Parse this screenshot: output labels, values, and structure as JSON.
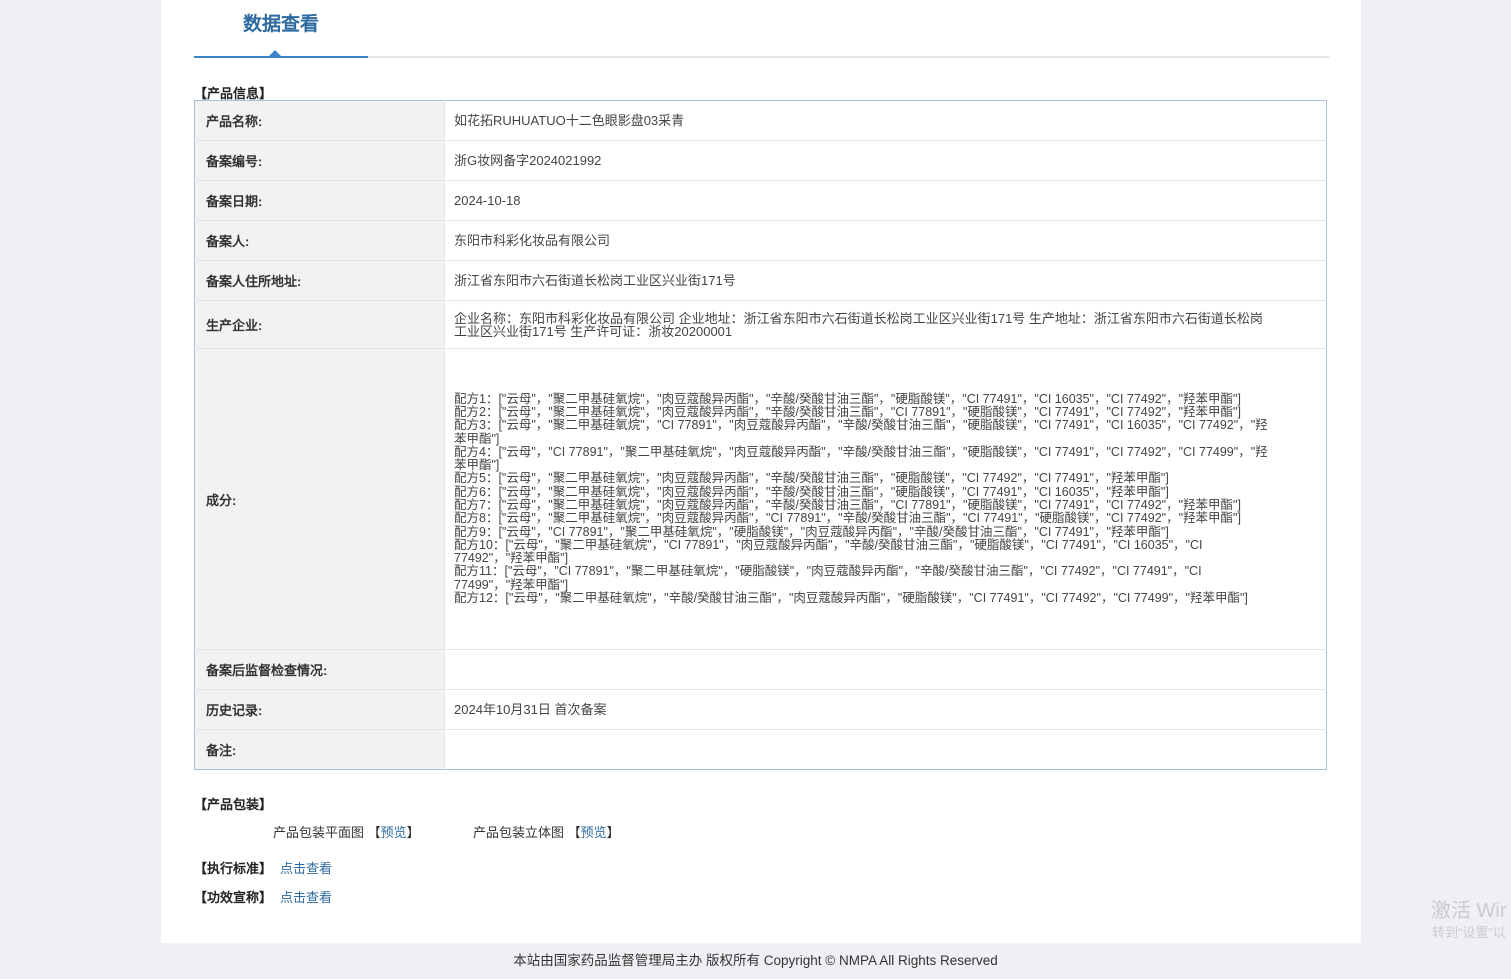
{
  "header": {
    "tab_title": "数据查看"
  },
  "product_info": {
    "section_title": "【产品信息】",
    "rows": [
      {
        "label": "产品名称:",
        "value": "如花拓RUHUATUO十二色眼影盘03采青"
      },
      {
        "label": "备案编号:",
        "value": "浙G妆网备字2024021992"
      },
      {
        "label": "备案日期:",
        "value": "2024-10-18"
      },
      {
        "label": "备案人:",
        "value": "东阳市科彩化妆品有限公司"
      },
      {
        "label": "备案人住所地址:",
        "value": "浙江省东阳市六石街道长松岗工业区兴业街171号"
      },
      {
        "label": "生产企业:",
        "value": "企业名称：东阳市科彩化妆品有限公司 企业地址：浙江省东阳市六石街道长松岗工业区兴业街171号 生产地址：浙江省东阳市六石街道长松岗工业区兴业街171号 生产许可证：浙妆20200001"
      },
      {
        "label": "成分:",
        "lines": [
          "配方1：[\"云母\"，\"聚二甲基硅氧烷\"，\"肉豆蔻酸异丙酯\"，\"辛酸/癸酸甘油三酯\"，\"硬脂酸镁\"，\"CI 77491\"，\"CI 16035\"，\"CI 77492\"，\"羟苯甲酯\"]",
          "配方2：[\"云母\"，\"聚二甲基硅氧烷\"，\"肉豆蔻酸异丙酯\"，\"辛酸/癸酸甘油三酯\"，\"CI 77891\"，\"硬脂酸镁\"，\"CI 77491\"，\"CI 77492\"，\"羟苯甲酯\"]",
          "配方3：[\"云母\"，\"聚二甲基硅氧烷\"，\"CI 77891\"，\"肉豆蔻酸异丙酯\"，\"辛酸/癸酸甘油三酯\"，\"硬脂酸镁\"，\"CI 77491\"，\"CI 16035\"，\"CI 77492\"，\"羟苯甲酯\"]",
          "配方4：[\"云母\"，\"CI 77891\"，\"聚二甲基硅氧烷\"，\"肉豆蔻酸异丙酯\"，\"辛酸/癸酸甘油三酯\"，\"硬脂酸镁\"，\"CI 77491\"，\"CI 77492\"，\"CI 77499\"，\"羟苯甲酯\"]",
          "配方5：[\"云母\"，\"聚二甲基硅氧烷\"，\"肉豆蔻酸异丙酯\"，\"辛酸/癸酸甘油三酯\"，\"硬脂酸镁\"，\"CI 77492\"，\"CI 77491\"，\"羟苯甲酯\"]",
          "配方6：[\"云母\"，\"聚二甲基硅氧烷\"，\"肉豆蔻酸异丙酯\"，\"辛酸/癸酸甘油三酯\"，\"硬脂酸镁\"，\"CI 77491\"，\"CI 16035\"，\"羟苯甲酯\"]",
          "配方7：[\"云母\"，\"聚二甲基硅氧烷\"，\"肉豆蔻酸异丙酯\"，\"辛酸/癸酸甘油三酯\"，\"CI 77891\"，\"硬脂酸镁\"，\"CI 77491\"，\"CI 77492\"，\"羟苯甲酯\"]",
          "配方8：[\"云母\"，\"聚二甲基硅氧烷\"，\"肉豆蔻酸异丙酯\"，\"CI 77891\"，\"辛酸/癸酸甘油三酯\"，\"CI 77491\"，\"硬脂酸镁\"，\"CI 77492\"，\"羟苯甲酯\"]",
          "配方9：[\"云母\"，\"CI 77891\"，\"聚二甲基硅氧烷\"，\"硬脂酸镁\"，\"肉豆蔻酸异丙酯\"，\"辛酸/癸酸甘油三酯\"，\"CI 77491\"，\"羟苯甲酯\"]",
          "配方10：[\"云母\"，\"聚二甲基硅氧烷\"，\"CI 77891\"，\"肉豆蔻酸异丙酯\"，\"辛酸/癸酸甘油三酯\"，\"硬脂酸镁\"，\"CI 77491\"，\"CI 16035\"，\"CI 77492\"，\"羟苯甲酯\"]",
          "配方11：[\"云母\"，\"CI 77891\"，\"聚二甲基硅氧烷\"，\"硬脂酸镁\"，\"肉豆蔻酸异丙酯\"，\"辛酸/癸酸甘油三酯\"，\"CI 77492\"，\"CI 77491\"，\"CI 77499\"，\"羟苯甲酯\"]",
          "配方12：[\"云母\"，\"聚二甲基硅氧烷\"，\"辛酸/癸酸甘油三酯\"，\"肉豆蔻酸异丙酯\"，\"硬脂酸镁\"，\"CI 77491\"，\"CI 77492\"，\"CI 77499\"，\"羟苯甲酯\"]"
        ]
      },
      {
        "label": "备案后监督检查情况:",
        "value": ""
      },
      {
        "label": "历史记录:",
        "value": "2024年10月31日 首次备案"
      },
      {
        "label": "备注:",
        "value": ""
      }
    ]
  },
  "packaging": {
    "section_title": "【产品包装】",
    "flat_label": "产品包装平面图",
    "flat_link": "预览",
    "three_d_label": "产品包装立体图",
    "three_d_link": "预览",
    "bracket_open": "【",
    "bracket_close": "】"
  },
  "standard": {
    "label": "【执行标准】",
    "link": "点击查看"
  },
  "efficacy": {
    "label": "【功效宣称】",
    "link": "点击查看"
  },
  "footer": {
    "text": "本站由国家药品监督管理局主办 版权所有 Copyright © NMPA All Rights Reserved"
  },
  "watermark": {
    "line1": "激活 Wir",
    "line2": "转到“设置”以"
  }
}
